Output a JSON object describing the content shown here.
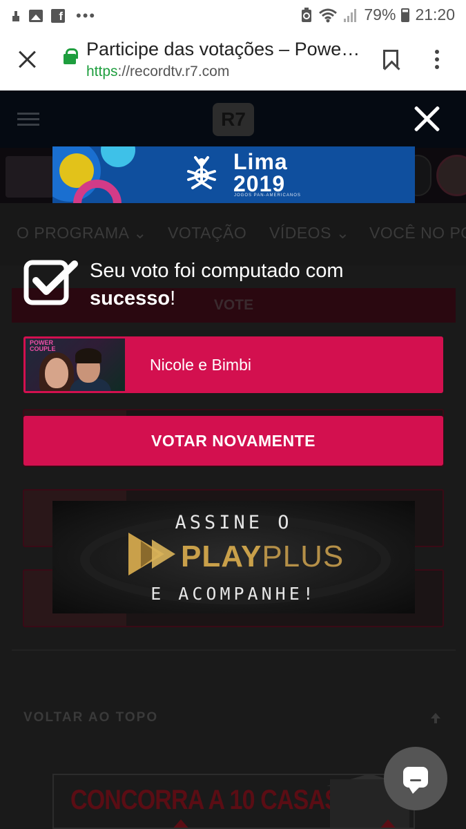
{
  "status_bar": {
    "battery": "79%",
    "time": "21:20",
    "notification_dots": "•••"
  },
  "browser": {
    "title": "Participe das votações – Power Couple",
    "url_scheme": "https",
    "url_rest": "://recordtv.r7.com"
  },
  "site": {
    "logo": "R7",
    "nav_items": [
      "O PROGRAMA",
      "VOTAÇÃO",
      "VÍDEOS",
      "VOCÊ NO PO"
    ],
    "vote_header": "VOTE",
    "back_to_top": "VOLTAR AO TOPO"
  },
  "ads": {
    "lima": {
      "title_line1": "Lima",
      "title_line2": "2019",
      "subtitle": "JOGOS PAN-AMERICANOS"
    },
    "playplus": {
      "top": "ASSINE O",
      "brand_play": "PLAY",
      "brand_plus": "PLUS",
      "bottom": "E ACOMPANHE!"
    },
    "casas": {
      "text": "CONCORRA A 10 CASAS"
    }
  },
  "modal": {
    "message_prefix": "Seu voto foi computado com",
    "message_strong": "sucesso",
    "message_suffix": "!",
    "selected_choice": "Nicole e Bimbi",
    "photo_logo_line1": "POWER",
    "photo_logo_line2": "COUPLE",
    "revote_button": "VOTAR NOVAMENTE"
  },
  "colors": {
    "accent": "#d3104f",
    "secure_green": "#1e9e3e",
    "overlay_bg": "#1a1a1a"
  }
}
